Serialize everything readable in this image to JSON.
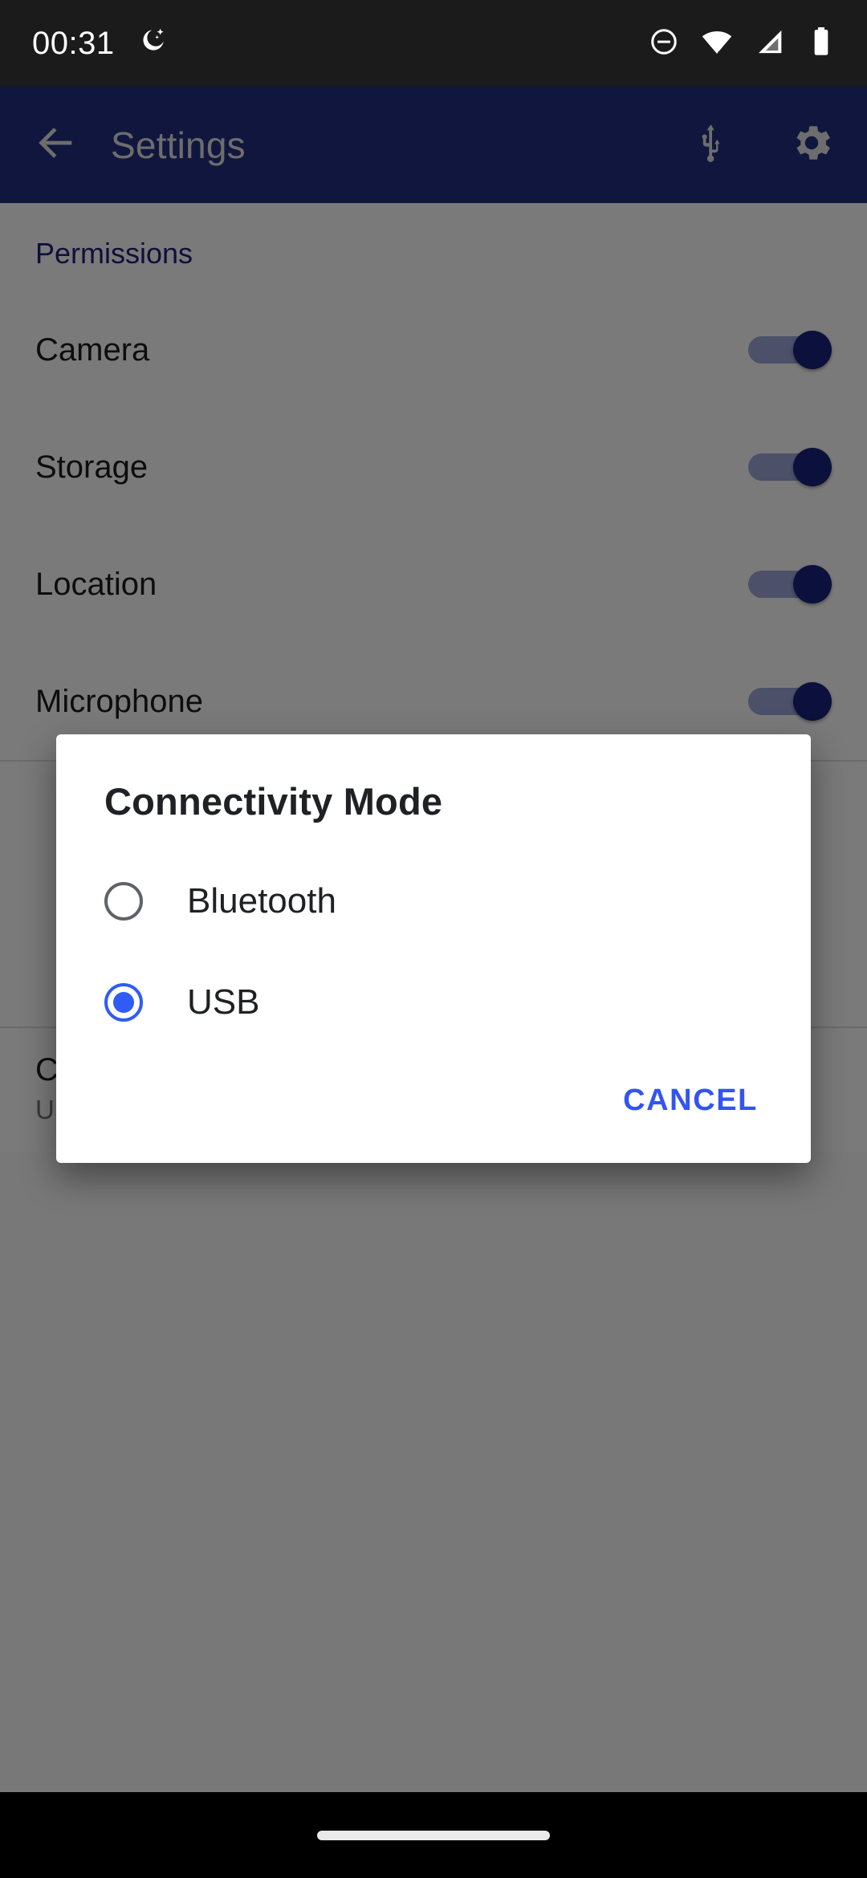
{
  "status_bar": {
    "clock": "00:31",
    "left_icons": [
      {
        "name": "do-not-disturb-night-icon",
        "glyph": "moon-stars"
      }
    ],
    "right_icons": [
      {
        "name": "do-not-disturb-icon",
        "glyph": "circle-minus"
      },
      {
        "name": "wifi-icon",
        "glyph": "wifi"
      },
      {
        "name": "cellular-signal-icon",
        "glyph": "signal"
      },
      {
        "name": "battery-icon",
        "glyph": "battery"
      }
    ],
    "background": "#1b1b1b"
  },
  "app_bar": {
    "title": "Settings",
    "back_icon": "arrow-back-icon",
    "actions": [
      {
        "name": "usb-icon",
        "label": "USB"
      },
      {
        "name": "gear-icon",
        "label": "Settings"
      }
    ],
    "background": "#283593"
  },
  "content": {
    "section_header": "Permissions",
    "permission_rows": [
      {
        "label": "Camera",
        "enabled": true
      },
      {
        "label": "Storage",
        "enabled": true
      },
      {
        "label": "Location",
        "enabled": true
      },
      {
        "label": "Microphone",
        "enabled": true
      }
    ],
    "extra_rows": [
      {
        "label": "Connectivity Mode",
        "value": "USB"
      }
    ],
    "accent_color": "#1a237e",
    "section_header_color": "#1a237e"
  },
  "dialog": {
    "title": "Connectivity Mode",
    "options": [
      {
        "label": "Bluetooth",
        "selected": false
      },
      {
        "label": "USB",
        "selected": true
      }
    ],
    "cancel_label": "CANCEL",
    "selected_color": "#2f5cf5",
    "cancel_color": "#3355ee",
    "background": "#ffffff"
  },
  "nav_bar": {
    "handle": "gesture-nav-handle"
  }
}
